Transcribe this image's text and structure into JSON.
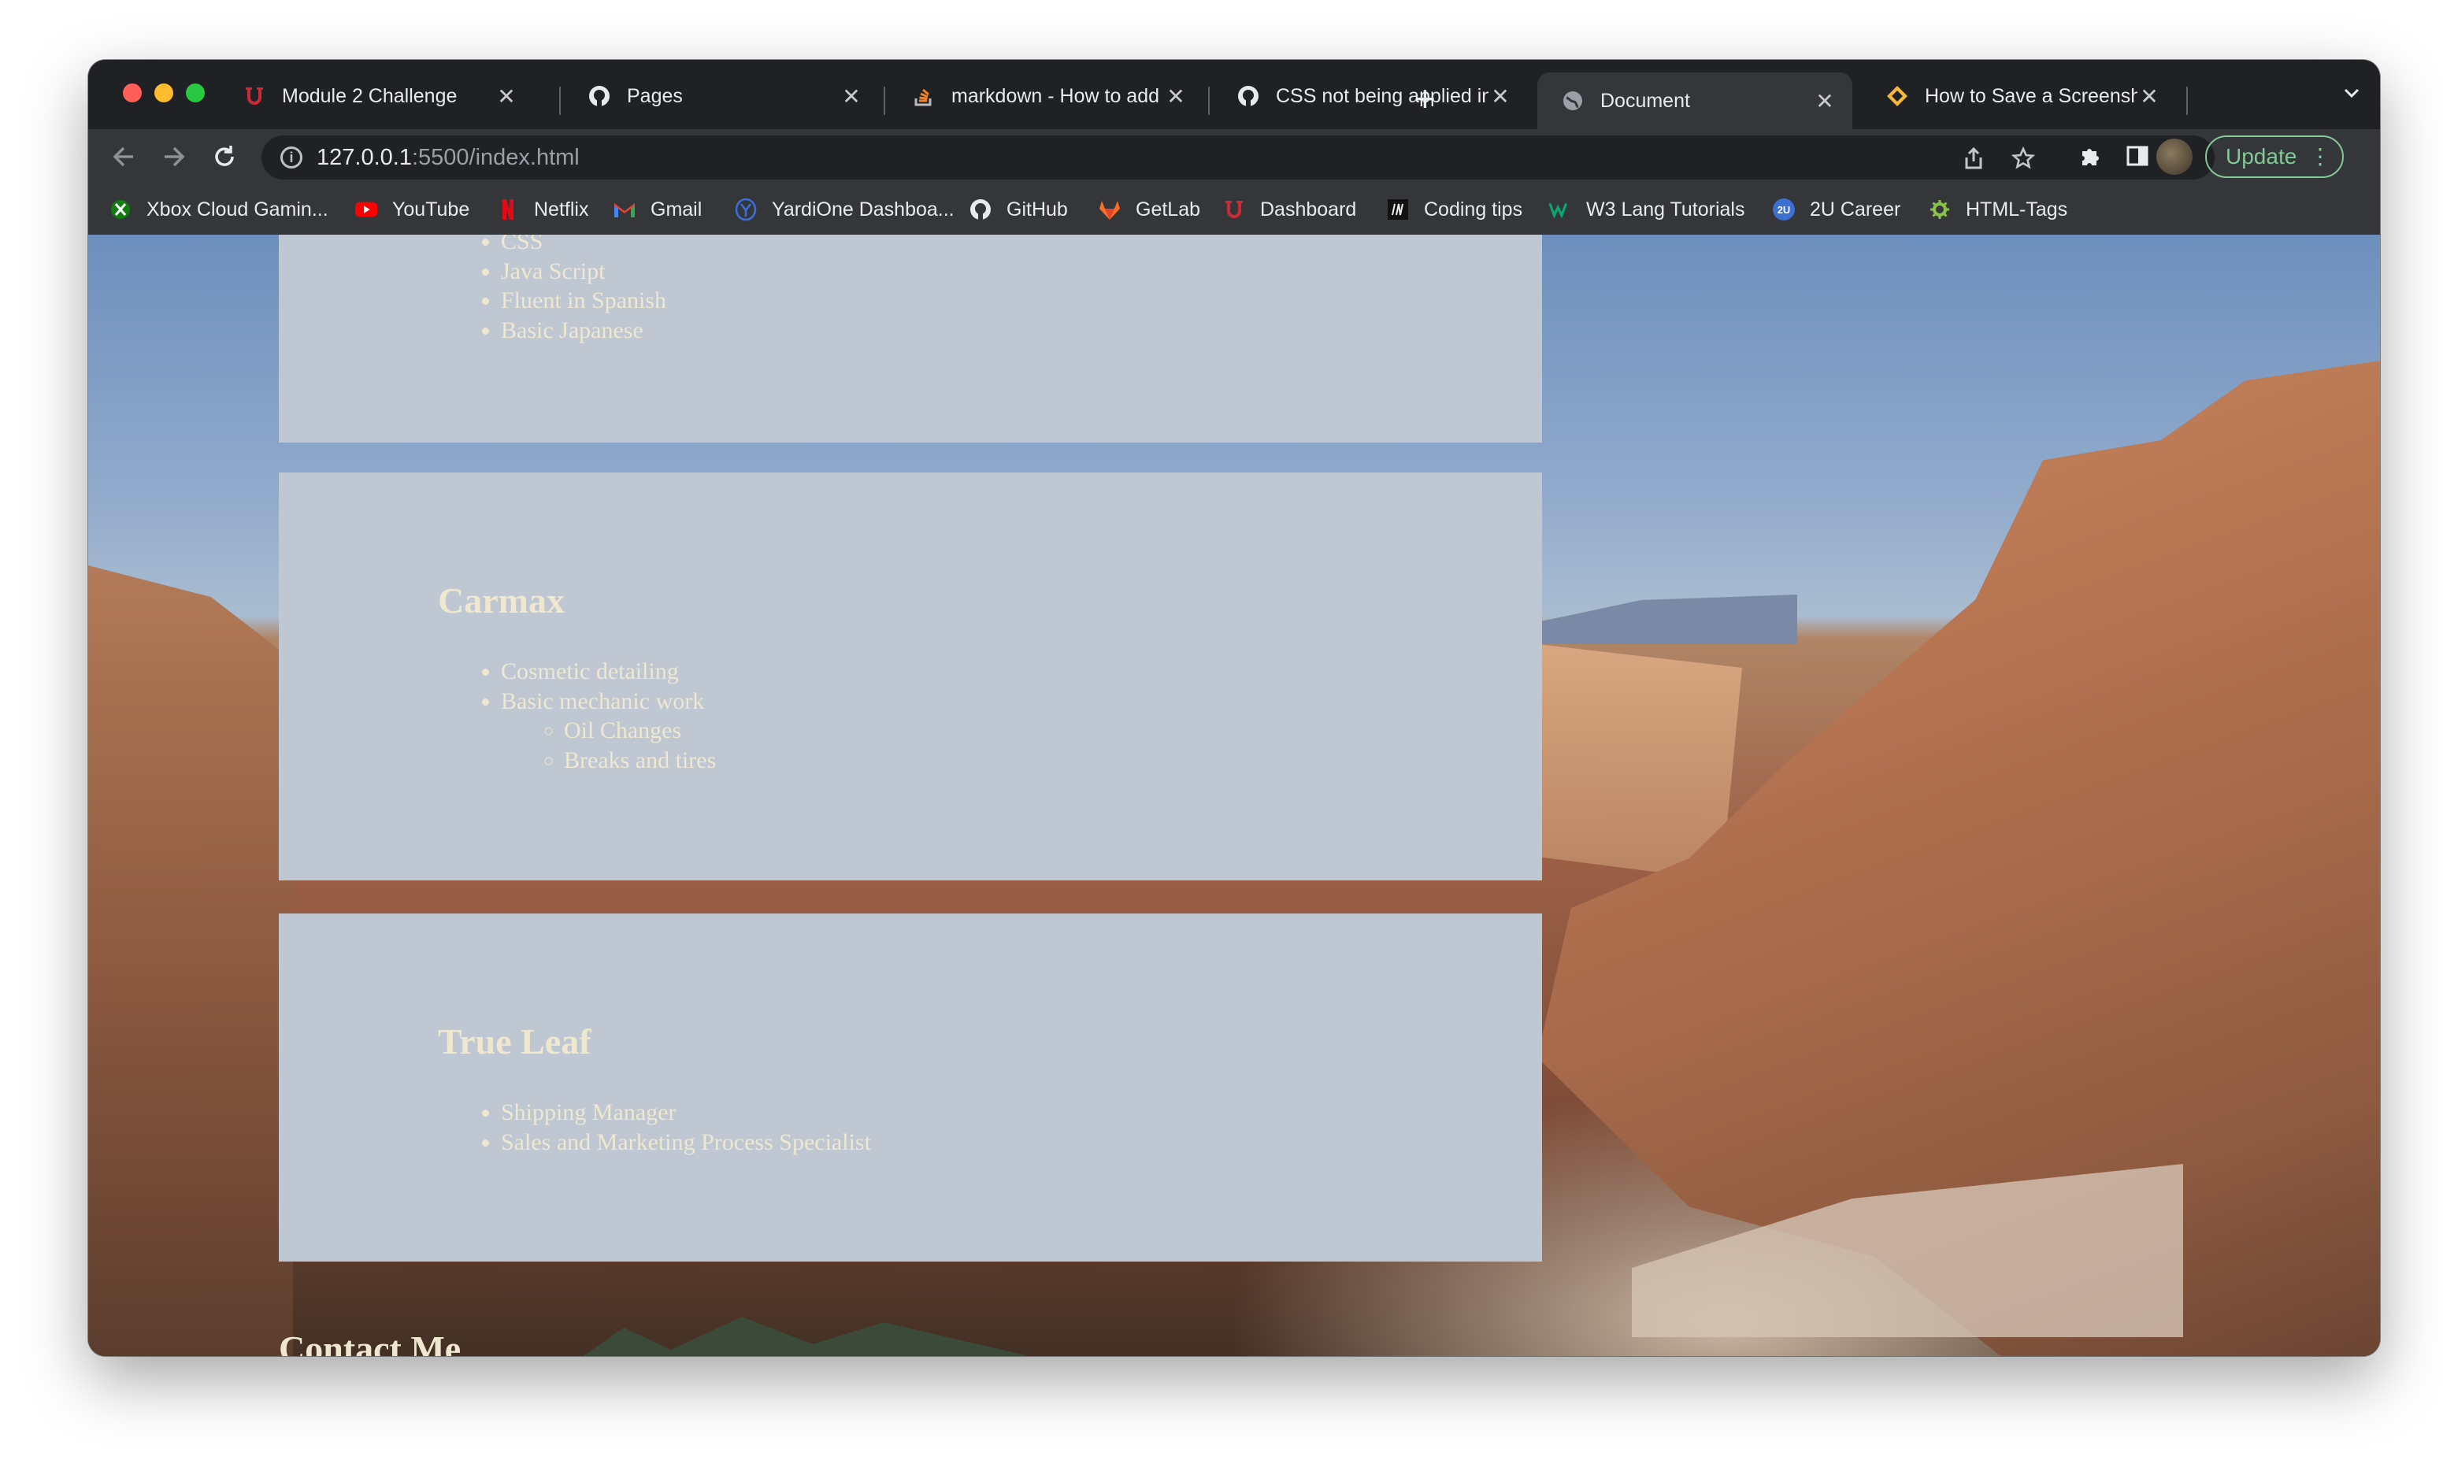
{
  "browser": {
    "tabs": [
      {
        "title": "Module 2 Challenge",
        "icon": "utah-u-icon",
        "icon_color": "#cc2b36"
      },
      {
        "title": "Pages",
        "icon": "github-icon",
        "icon_color": "#e8eaed"
      },
      {
        "title": "markdown - How to add",
        "icon": "stackoverflow-icon",
        "icon_color": "#f48024"
      },
      {
        "title": "CSS not being applied in",
        "icon": "github-icon",
        "icon_color": "#e8eaed"
      },
      {
        "title": "Document",
        "icon": "globe-icon",
        "icon_color": "#9aa0a6",
        "active": true
      },
      {
        "title": "How to Save a Screensh",
        "icon": "diamond-icon",
        "icon_color": "#f6b73c"
      }
    ],
    "url_host": "127.0.0.1",
    "url_rest": ":5500/index.html",
    "update_label": "Update",
    "bookmarks": [
      {
        "label": "Xbox Cloud Gamin...",
        "icon": "xbox-icon",
        "color": "#107c10"
      },
      {
        "label": "YouTube",
        "icon": "youtube-icon",
        "color": "#ff0000"
      },
      {
        "label": "Netflix",
        "icon": "netflix-icon",
        "color": "#e50914"
      },
      {
        "label": "Gmail",
        "icon": "gmail-icon",
        "color": "#ea4335"
      },
      {
        "label": "YardiOne Dashboa...",
        "icon": "yardi-icon",
        "color": "#3a6fd8"
      },
      {
        "label": "GitHub",
        "icon": "github-icon",
        "color": "#e8eaed"
      },
      {
        "label": "GetLab",
        "icon": "gitlab-icon",
        "color": "#fc6d26"
      },
      {
        "label": "Dashboard",
        "icon": "utah-u-icon",
        "color": "#cc2b36"
      },
      {
        "label": "Coding tips",
        "icon": "medium-icon",
        "color": "#e8eaed"
      },
      {
        "label": "W3 Lang Tutorials",
        "icon": "w3-icon",
        "color": "#04aa6d"
      },
      {
        "label": "2U Career",
        "icon": "2u-icon",
        "color": "#3d6fd0"
      },
      {
        "label": "HTML-Tags",
        "icon": "gear-icon",
        "color": "#8bc34a"
      }
    ]
  },
  "page": {
    "skills_tail": [
      "CSS",
      "Java Script",
      "Fluent in Spanish",
      "Basic Japanese"
    ],
    "jobs": [
      {
        "title": "Carmax",
        "duties": [
          "Cosmetic detailing",
          "Basic mechanic work"
        ],
        "subduties": [
          "Oil Changes",
          "Breaks and tires"
        ]
      },
      {
        "title": "True Leaf",
        "duties": [
          "Shipping Manager",
          "Sales and Marketing Process Specialist"
        ]
      }
    ],
    "contact_heading": "Contact Me",
    "text_color": "#efe7cf",
    "card_color": "#bec7d2"
  }
}
